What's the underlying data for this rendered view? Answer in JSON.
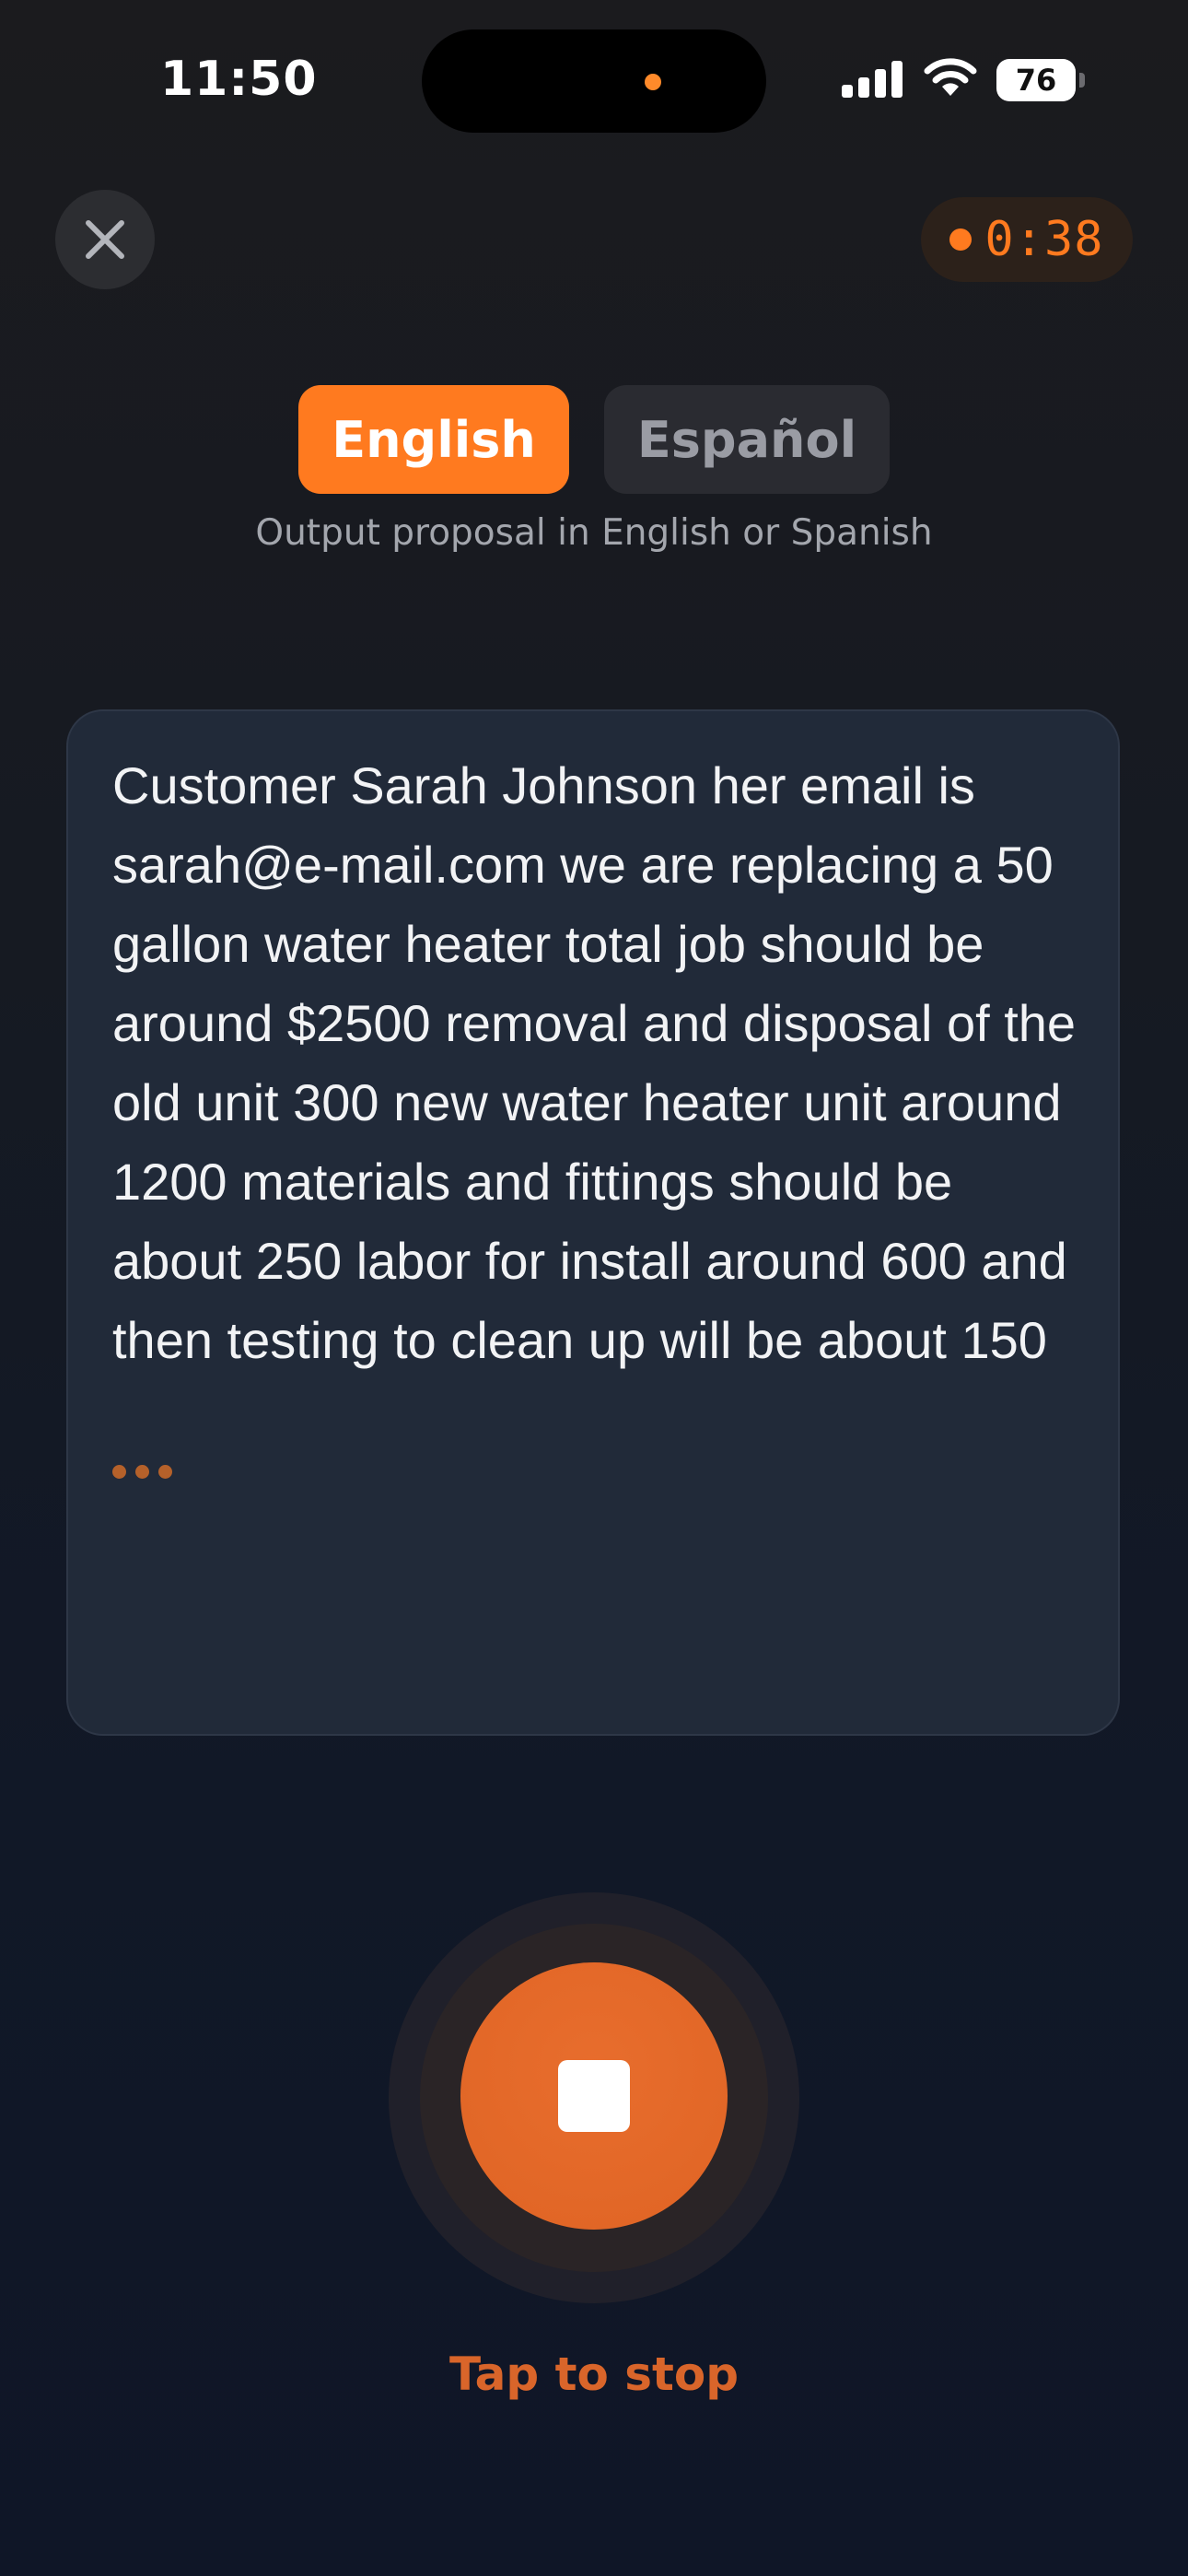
{
  "status_bar": {
    "time": "11:50",
    "battery_level": "76"
  },
  "timer": {
    "elapsed": "0:38"
  },
  "language": {
    "options": [
      "English",
      "Español"
    ],
    "selected": "English",
    "hint": "Output proposal in English or Spanish"
  },
  "transcript": {
    "text": "Customer Sarah Johnson her email is sarah@e-mail.com we are replacing a 50 gallon water heater total job should be around $2500 removal and disposal of the old unit 300 new water heater unit around 1200 materials and fittings should be about 250 labor for install around 600 and then testing to clean up will be about 150"
  },
  "recorder": {
    "action_label": "Tap to stop"
  },
  "icons": {
    "close": "close-icon",
    "stop": "stop-icon",
    "signal": "signal-icon",
    "wifi": "wifi-icon",
    "battery": "battery-icon"
  },
  "colors": {
    "accent": "#ff7a1f",
    "stop_button": "#e0662a",
    "card_background": "#212a39"
  }
}
